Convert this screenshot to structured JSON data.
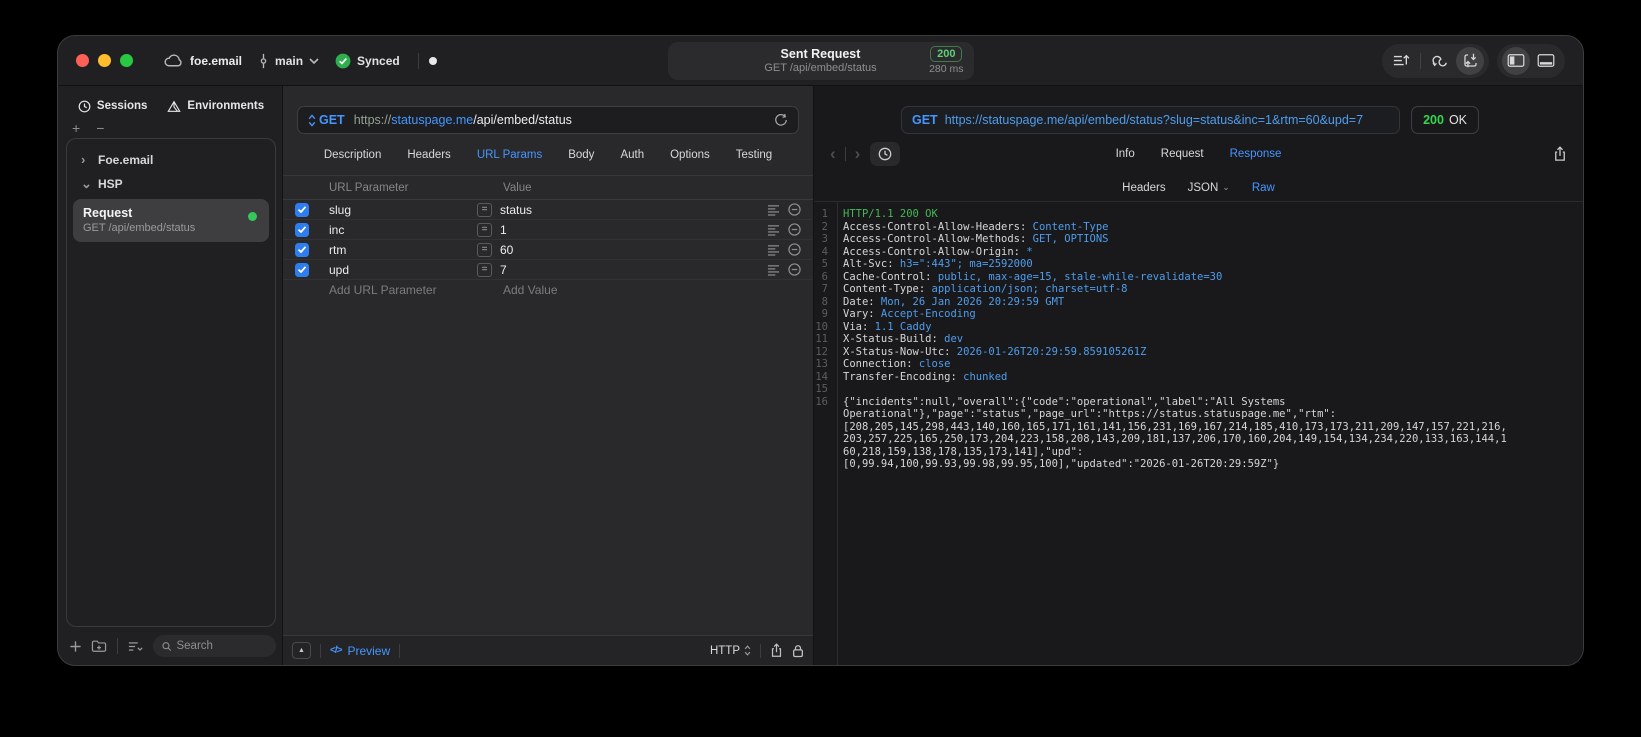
{
  "colors": {
    "accent_blue": "#4596ff",
    "status_green": "#34c759",
    "code_value_blue": "#4f9ded",
    "code_green": "#44b854",
    "checkbox_blue": "#2e7ef0",
    "badge_green": "#32d74b"
  },
  "icons": {
    "plus": "+",
    "minus": "−",
    "collapse": "▲",
    "back": "‹",
    "forward": "›",
    "chevron_right": "›",
    "chevron_down": "⌄",
    "equals": "=",
    "code": "</>"
  },
  "titlebar": {
    "project": "foe.email",
    "branch": "main",
    "sync_status": "Synced",
    "center": {
      "title": "Sent Request",
      "subtitle": "GET /api/embed/status",
      "status_code": "200",
      "duration": "280 ms"
    }
  },
  "sidebar": {
    "tabs": [
      "Sessions",
      "Environments"
    ],
    "tree": {
      "group1": "Foe.email",
      "group2": "HSP",
      "request": {
        "title": "Request",
        "subtitle": "GET /api/embed/status"
      }
    },
    "search_placeholder": "Search"
  },
  "request_panel": {
    "method": "GET",
    "url_scheme": "https://",
    "url_host": "statuspage.me",
    "url_path": "/api/embed/status",
    "tabs": [
      "Description",
      "Headers",
      "URL Params",
      "Body",
      "Auth",
      "Options",
      "Testing"
    ],
    "active_tab": "URL Params",
    "table": {
      "col_param": "URL Parameter",
      "col_value": "Value",
      "rows": [
        {
          "name": "slug",
          "value": "status"
        },
        {
          "name": "inc",
          "value": "1"
        },
        {
          "name": "rtm",
          "value": "60"
        },
        {
          "name": "upd",
          "value": "7"
        }
      ],
      "add_param": "Add URL Parameter",
      "add_value": "Add Value"
    },
    "footer": {
      "preview": "Preview",
      "protocol": "HTTP"
    }
  },
  "response_panel": {
    "method": "GET",
    "url": "https://statuspage.me/api/embed/status?slug=status&inc=1&rtm=60&upd=7",
    "status_code": "200",
    "status_text": "OK",
    "tabs": [
      "Info",
      "Request",
      "Response"
    ],
    "active_tab": "Response",
    "subtabs": [
      "Headers",
      "JSON",
      "Raw"
    ],
    "active_subtab": "Raw",
    "body_lines": [
      {
        "n": "1",
        "parts": [
          {
            "t": "HTTP/1.1 200 OK",
            "c": "g"
          }
        ]
      },
      {
        "n": "2",
        "parts": [
          {
            "t": "Access-Control-Allow-Headers:",
            "c": "k"
          },
          {
            "t": " Content-Type",
            "c": "v"
          }
        ]
      },
      {
        "n": "3",
        "parts": [
          {
            "t": "Access-Control-Allow-Methods:",
            "c": "k"
          },
          {
            "t": " GET, OPTIONS",
            "c": "v"
          }
        ]
      },
      {
        "n": "4",
        "parts": [
          {
            "t": "Access-Control-Allow-Origin:",
            "c": "k"
          },
          {
            "t": " *",
            "c": "v"
          }
        ]
      },
      {
        "n": "5",
        "parts": [
          {
            "t": "Alt-Svc:",
            "c": "k"
          },
          {
            "t": " h3=\":443\"; ma=2592000",
            "c": "v"
          }
        ]
      },
      {
        "n": "6",
        "parts": [
          {
            "t": "Cache-Control:",
            "c": "k"
          },
          {
            "t": " public, max-age=15, stale-while-revalidate=30",
            "c": "v"
          }
        ]
      },
      {
        "n": "7",
        "parts": [
          {
            "t": "Content-Type:",
            "c": "k"
          },
          {
            "t": " application/json; charset=utf-8",
            "c": "v"
          }
        ]
      },
      {
        "n": "8",
        "parts": [
          {
            "t": "Date:",
            "c": "k"
          },
          {
            "t": " Mon, 26 Jan 2026 20:29:59 GMT",
            "c": "v"
          }
        ]
      },
      {
        "n": "9",
        "parts": [
          {
            "t": "Vary:",
            "c": "k"
          },
          {
            "t": " Accept-Encoding",
            "c": "v"
          }
        ]
      },
      {
        "n": "10",
        "parts": [
          {
            "t": "Via:",
            "c": "k"
          },
          {
            "t": " 1.1 Caddy",
            "c": "v"
          }
        ]
      },
      {
        "n": "11",
        "parts": [
          {
            "t": "X-Status-Build:",
            "c": "k"
          },
          {
            "t": " dev",
            "c": "v"
          }
        ]
      },
      {
        "n": "12",
        "parts": [
          {
            "t": "X-Status-Now-Utc:",
            "c": "k"
          },
          {
            "t": " 2026-01-26T20:29:59.859105261Z",
            "c": "v"
          }
        ]
      },
      {
        "n": "13",
        "parts": [
          {
            "t": "Connection:",
            "c": "k"
          },
          {
            "t": " close",
            "c": "v"
          }
        ]
      },
      {
        "n": "14",
        "parts": [
          {
            "t": "Transfer-Encoding:",
            "c": "k"
          },
          {
            "t": " chunked",
            "c": "v"
          }
        ]
      },
      {
        "n": "15",
        "parts": []
      },
      {
        "n": "16",
        "parts": [
          {
            "t": "{\"incidents\":null,\"overall\":{\"code\":\"operational\",\"label\":\"All Systems\nOperational\"},\"page\":\"status\",\"page_url\":\"https://status.statuspage.me\",\"rtm\":\n[208,205,145,298,443,140,160,165,171,161,141,156,231,169,167,214,185,410,173,173,211,209,147,157,221,216,\n203,257,225,165,250,173,204,223,158,208,143,209,181,137,206,170,160,204,149,154,134,234,220,133,163,144,1\n60,218,159,138,178,135,173,141],\"upd\":\n[0,99.94,100,99.93,99.98,99.95,100],\"updated\":\"2026-01-26T20:29:59Z\"}",
            "c": "k"
          }
        ]
      }
    ]
  }
}
